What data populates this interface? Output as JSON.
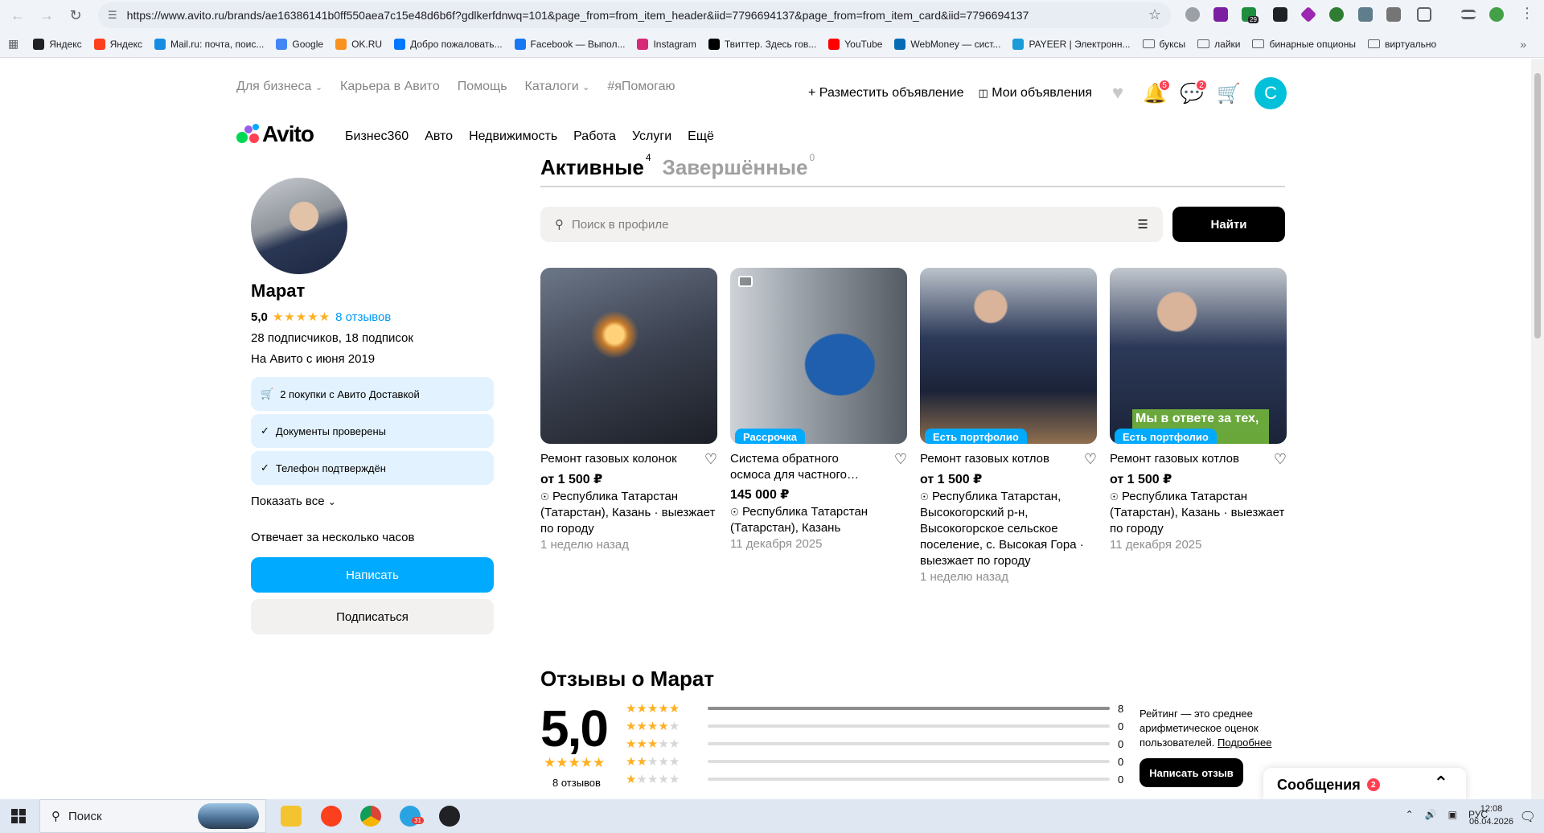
{
  "browser": {
    "url": "https://www.avito.ru/brands/ae16386141b0ff550aea7c15e48d6b6f?gdlkerfdnwq=101&page_from=from_item_header&iid=7796694137&page_from=from_item_card&iid=7796694137",
    "ext_badge": "29"
  },
  "bookmarks": [
    {
      "label": "Яндекс",
      "icon": "plus-square-icon",
      "color": "#202124"
    },
    {
      "label": "Яндекс",
      "icon": "yandex-icon",
      "color": "#fc3f1d"
    },
    {
      "label": "Mail.ru: почта, поис...",
      "icon": "mail-icon",
      "color": "#168de2"
    },
    {
      "label": "Google",
      "icon": "google-icon",
      "color": "#4285f4"
    },
    {
      "label": "OK.RU",
      "icon": "ok-icon",
      "color": "#f7931e"
    },
    {
      "label": "Добро пожаловать...",
      "icon": "vk-icon",
      "color": "#0077ff"
    },
    {
      "label": "Facebook — Выпол...",
      "icon": "facebook-icon",
      "color": "#1877f2"
    },
    {
      "label": "Instagram",
      "icon": "instagram-icon",
      "color": "#d62976"
    },
    {
      "label": "Твиттер. Здесь гов...",
      "icon": "x-icon",
      "color": "#000000"
    },
    {
      "label": "YouTube",
      "icon": "youtube-icon",
      "color": "#ff0000"
    },
    {
      "label": "WebMoney — сист...",
      "icon": "webmoney-icon",
      "color": "#036cb5"
    },
    {
      "label": "PAYEER | Электронн...",
      "icon": "payeer-icon",
      "color": "#1a9cd8"
    }
  ],
  "bookmark_folders": [
    "буксы",
    "лайки",
    "бинарные опционы",
    "виртуально"
  ],
  "header": {
    "nav": [
      "Для бизнеса",
      "Карьера в Авито",
      "Помощь",
      "Каталоги",
      "#яПомогаю"
    ],
    "post_ad": "Разместить объявление",
    "my_ads": "Мои объявления",
    "notif_count": "5",
    "msg_count": "2",
    "user_initial": "С"
  },
  "logo_text": "Avito",
  "main_nav": [
    "Бизнес360",
    "Авто",
    "Недвижимость",
    "Работа",
    "Услуги",
    "Ещё"
  ],
  "profile": {
    "name": "Марат",
    "rating": "5,0",
    "reviews_link": "8 отзывов",
    "followers": "28 подписчиков, 18 подписок",
    "since": "На Авито с июня 2019",
    "badges": [
      "2 покупки с Авито Доставкой",
      "Документы проверены",
      "Телефон подтверждён"
    ],
    "show_all": "Показать все",
    "response": "Отвечает за несколько часов",
    "write": "Написать",
    "subscribe": "Подписаться"
  },
  "tabs": {
    "active": "Активные",
    "active_count": "4",
    "done": "Завершённые",
    "done_count": "0"
  },
  "search": {
    "placeholder": "Поиск в профиле",
    "button": "Найти"
  },
  "listings": [
    {
      "title": "Ремонт газовых колонок",
      "price": "от 1 500 ₽",
      "location": "Республика Татарстан (Татарстан), Казань · выезжает по городу",
      "date": "1 неделю назад",
      "tag": ""
    },
    {
      "title": "Система обратного осмоса для частного…",
      "price": "145 000 ₽",
      "location": "Республика Татарстан (Татарстан), Казань",
      "date": "11 декабря 2025",
      "tag": "Рассрочка"
    },
    {
      "title": "Ремонт газовых котлов",
      "price": "от 1 500 ₽",
      "location": "Республика Татарстан, Высокогорский р-н, Высокогорское сельское поселение, с. Высокая Гора · выезжает по городу",
      "date": "1 неделю назад",
      "tag": "Есть портфолио"
    },
    {
      "title": "Ремонт газовых котлов",
      "price": "от 1 500 ₽",
      "location": "Республика Татарстан (Татарстан), Казань · выезжает по городу",
      "date": "11 декабря 2025",
      "tag": "Есть портфолио",
      "overlay": "Мы в ответе за тех, нили!"
    }
  ],
  "reviews": {
    "title": "Отзывы о Марат",
    "rating": "5,0",
    "count": "8 отзывов",
    "distribution": [
      {
        "stars": 5,
        "count": 8
      },
      {
        "stars": 4,
        "count": 0
      },
      {
        "stars": 3,
        "count": 0
      },
      {
        "stars": 2,
        "count": 0
      },
      {
        "stars": 1,
        "count": 0
      }
    ],
    "info": "Рейтинг — это среднее арифметическое оценок пользователей.",
    "info_link": "Подробнее",
    "write_review": "Написать отзыв"
  },
  "messages_widget": {
    "label": "Сообщения",
    "count": "2"
  },
  "taskbar": {
    "search": "Поиск",
    "lang": "РУС",
    "time": "12:08",
    "date": "06.04.2026",
    "telegram_badge": "31"
  },
  "colors": {
    "accent": "#00aaff",
    "star": "#ffb021",
    "badge_red": "#ff4053",
    "info_bg": "#e2f2ff"
  }
}
